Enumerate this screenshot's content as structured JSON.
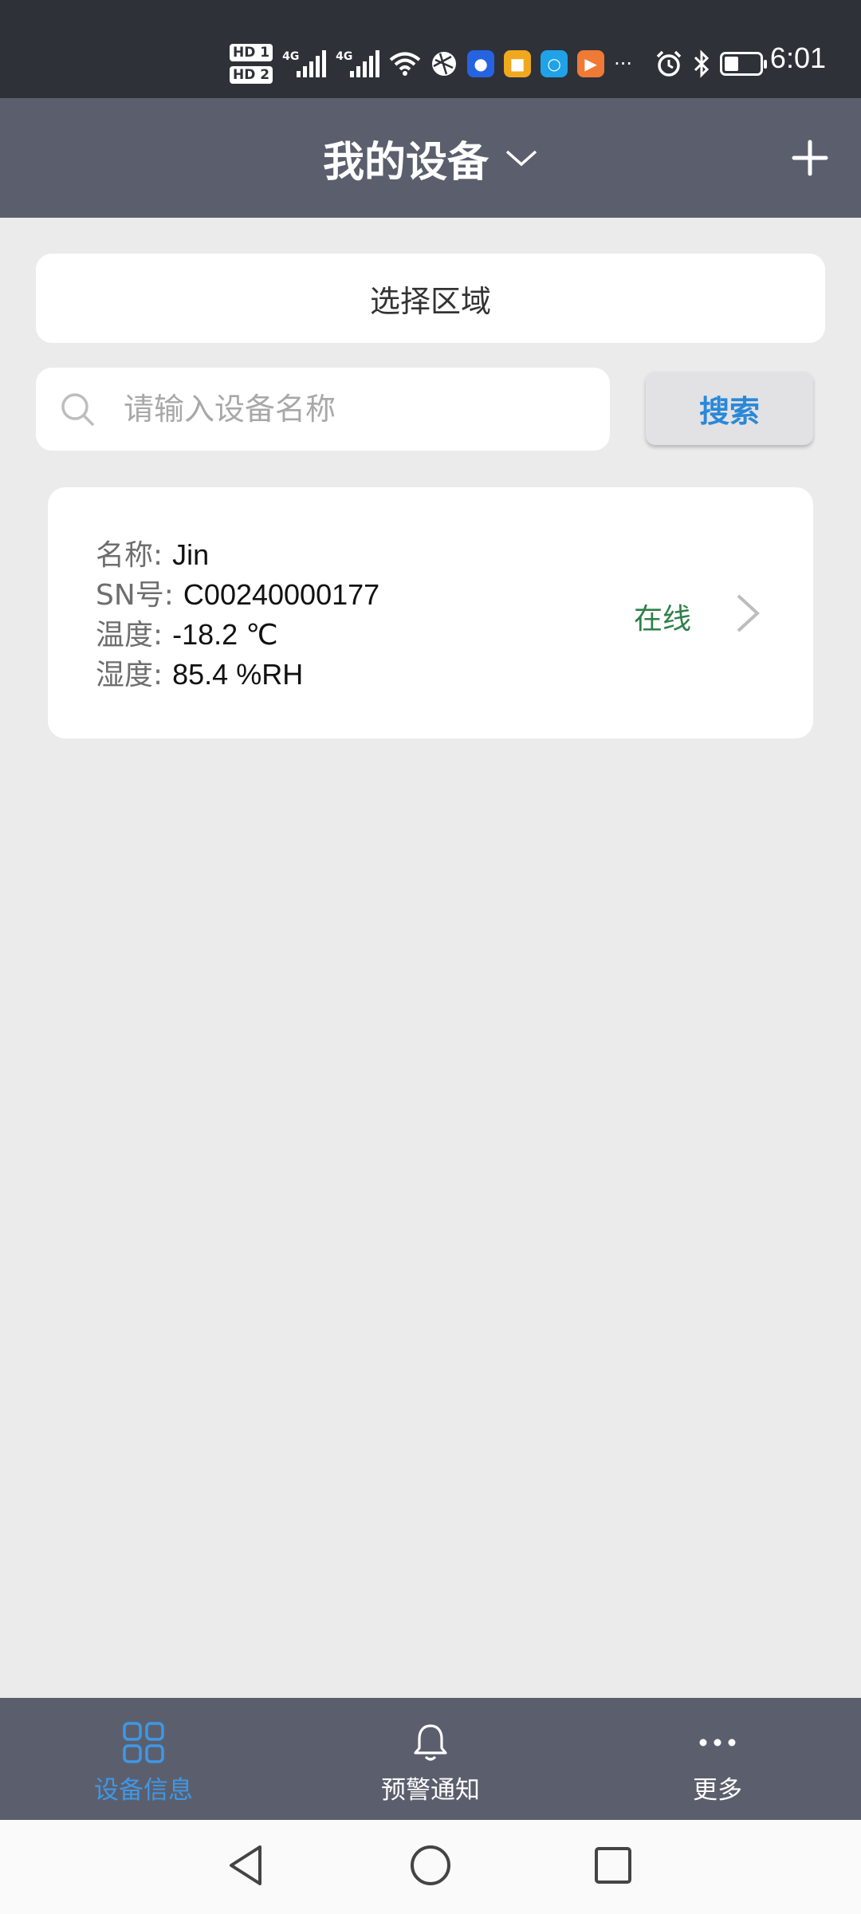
{
  "status_bar": {
    "hd1": "HD 1",
    "hd2": "HD 2",
    "net1": "4G",
    "net2": "4G",
    "overflow": "···",
    "time": "6:01",
    "icons": [
      "signal-icon",
      "signal-icon",
      "wifi-icon",
      "app-icon",
      "app-icon",
      "app-icon",
      "app-icon",
      "app-icon",
      "alarm-icon",
      "bluetooth-icon",
      "battery-icon"
    ]
  },
  "header": {
    "title": "我的设备",
    "dropdown_icon": "chevron-down-icon",
    "add_icon": "plus-icon"
  },
  "region": {
    "label": "选择区域"
  },
  "search": {
    "placeholder": "请输入设备名称",
    "value": "",
    "button_label": "搜索"
  },
  "devices": [
    {
      "name_label": "名称:",
      "name": "Jin",
      "sn_label": "SN号:",
      "sn": "C00240000177",
      "temp_label": "温度:",
      "temp": "-18.2 ℃",
      "humidity_label": "湿度:",
      "humidity": "85.4 %RH",
      "status": "在线"
    }
  ],
  "tabs": [
    {
      "label": "设备信息",
      "icon": "grid-icon",
      "active": true
    },
    {
      "label": "预警通知",
      "icon": "bell-icon",
      "active": false
    },
    {
      "label": "更多",
      "icon": "more-icon",
      "active": false
    }
  ],
  "colors": {
    "header_bg": "#5b5f6d",
    "accent": "#3f97e6",
    "online": "#2e8048",
    "page_bg": "#ebebeb"
  },
  "battery_level": 0.4
}
